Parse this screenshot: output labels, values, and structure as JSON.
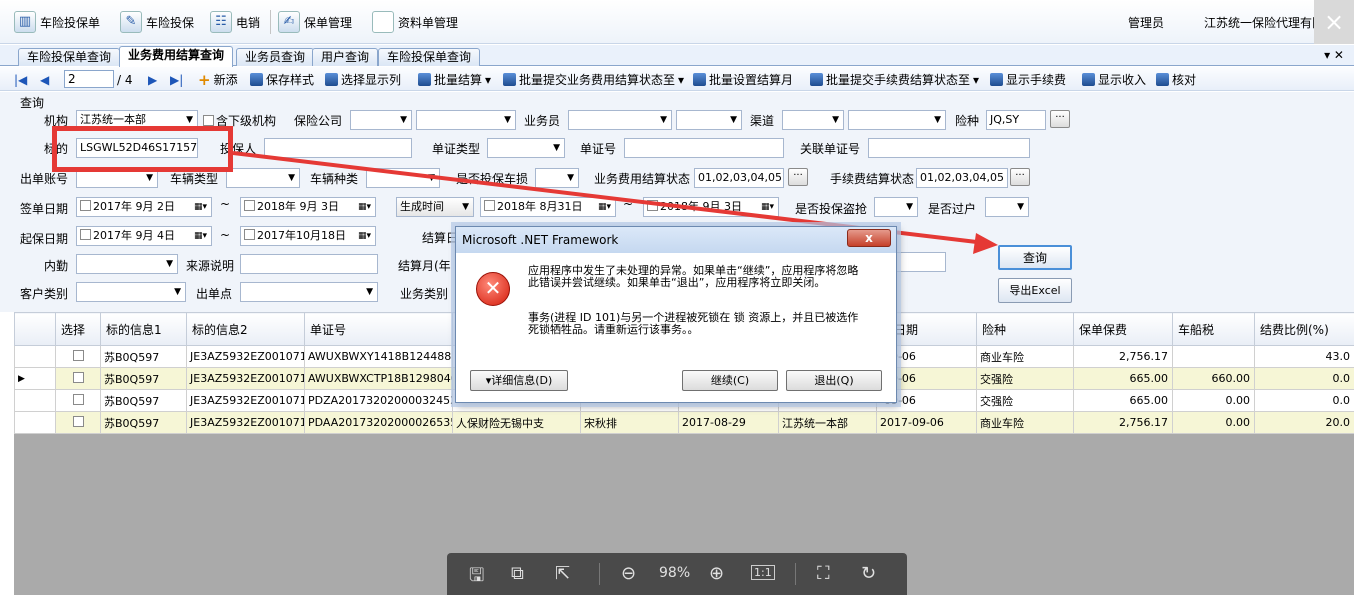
{
  "topmenu": {
    "items": [
      "车险投保单",
      "车险投保",
      "电销",
      "保单管理",
      "资料单管理"
    ],
    "user": "管理员",
    "company": "江苏统一保险代理有限公司"
  },
  "tabs": [
    "车险投保单查询",
    "业务费用结算查询",
    "业务员查询",
    "用户查询",
    "车险投保单查询"
  ],
  "toolbar": {
    "page_current": "2",
    "page_total": "/ 4",
    "add": "新添",
    "save_style": "保存样式",
    "select_cols": "选择显示列",
    "batch_settle": "批量结算",
    "batch_submit_status": "批量提交业务费用结算状态至",
    "batch_month": "批量设置结算月",
    "batch_fee_status": "批量提交手续费结算状态至",
    "show_fee": "显示手续费",
    "show_income": "显示收入",
    "verify": "核对"
  },
  "filter": {
    "group": "查询",
    "org_label": "机构",
    "org_value": "江苏统一本部",
    "include_sub": "含下级机构",
    "insurer_label": "保险公司",
    "salesman_label": "业务员",
    "channel_label": "渠道",
    "risk_label": "险种",
    "risk_value": "JQ,SY",
    "target_label": "标的",
    "target_value": "LSGWL52D46S171575",
    "applicant_label": "投保人",
    "doc_type_label": "单证类型",
    "doc_no_label": "单证号",
    "related_doc_label": "关联单证号",
    "issuer_label": "出单账号",
    "vehicle_type_label": "车辆类型",
    "vehicle_kind_label": "车辆种类",
    "vehicle_loss_label": "是否投保车损",
    "settle_status_label": "业务费用结算状态",
    "settle_status_value": "01,02,03,04,05",
    "fee_status_label": "手续费结算状态",
    "fee_status_value": "01,02,03,04,05",
    "sign_date_label": "签单日期",
    "sign_date_from": "2017年 9月 2日",
    "sign_date_to": "2018年 9月 3日",
    "gen_time": "生成时间",
    "gen_from": "2018年 8月31日",
    "gen_to": "2018年 9月 3日",
    "theft_label": "是否投保盗抢",
    "transfer_label": "是否过户",
    "start_date_label": "起保日期",
    "start_from": "2017年 9月 4日",
    "start_to": "2017年10月18日",
    "settle_date_label": "结算日",
    "inner_label": "内勤",
    "source_label": "来源说明",
    "settle_month_label": "结算月(年",
    "customer_label": "客户类别",
    "issue_point_label": "出单点",
    "biz_type_label": "业务类别",
    "query_btn": "查询",
    "export_btn": "导出Excel"
  },
  "grid": {
    "headers": [
      "选择",
      "标的信息1",
      "标的信息2",
      "单证号",
      "",
      "",
      "",
      "",
      "保日期",
      "险种",
      "保单保费",
      "车船税",
      "结费比例(%)"
    ],
    "rows": [
      [
        "",
        "苏B0Q597",
        "JE3AZ5932EZ001071",
        "AWUXBWXY1418B124488B",
        "",
        "",
        "",
        "",
        "-09-06",
        "商业车险",
        "2,756.17",
        "",
        "43.0"
      ],
      [
        "",
        "苏B0Q597",
        "JE3AZ5932EZ001071",
        "AWUXBWXCTP18B129804Q",
        "",
        "",
        "",
        "",
        "-09-06",
        "交强险",
        "665.00",
        "660.00",
        "0.0"
      ],
      [
        "",
        "苏B0Q597",
        "JE3AZ5932EZ001071",
        "PDZA201732020000324526",
        "",
        "",
        "",
        "",
        "-09-06",
        "交强险",
        "665.00",
        "0.00",
        "0.0"
      ],
      [
        "",
        "苏B0Q597",
        "JE3AZ5932EZ001071",
        "PDAA201732020000265353",
        "人保财险无锡中支",
        "宋秋排",
        "2017-08-29",
        "江苏统一本部",
        "2017-09-06",
        "商业车险",
        "2,756.17",
        "0.00",
        "20.0"
      ]
    ]
  },
  "dialog": {
    "title": "Microsoft .NET Framework",
    "close": "x",
    "msg1": "应用程序中发生了未处理的异常。如果单击“继续”，应用程序将忽略此错误并尝试继续。如果单击“退出”，应用程序将立即关闭。",
    "msg2": "事务(进程 ID 101)与另一个进程被死锁在 锁 资源上，并且已被选作死锁牺牲品。请重新运行该事务。。",
    "details": "▾详细信息(D)",
    "continue": "继续(C)",
    "quit": "退出(Q)"
  },
  "viewer": {
    "zoom": "98%",
    "actual": "1:1"
  }
}
